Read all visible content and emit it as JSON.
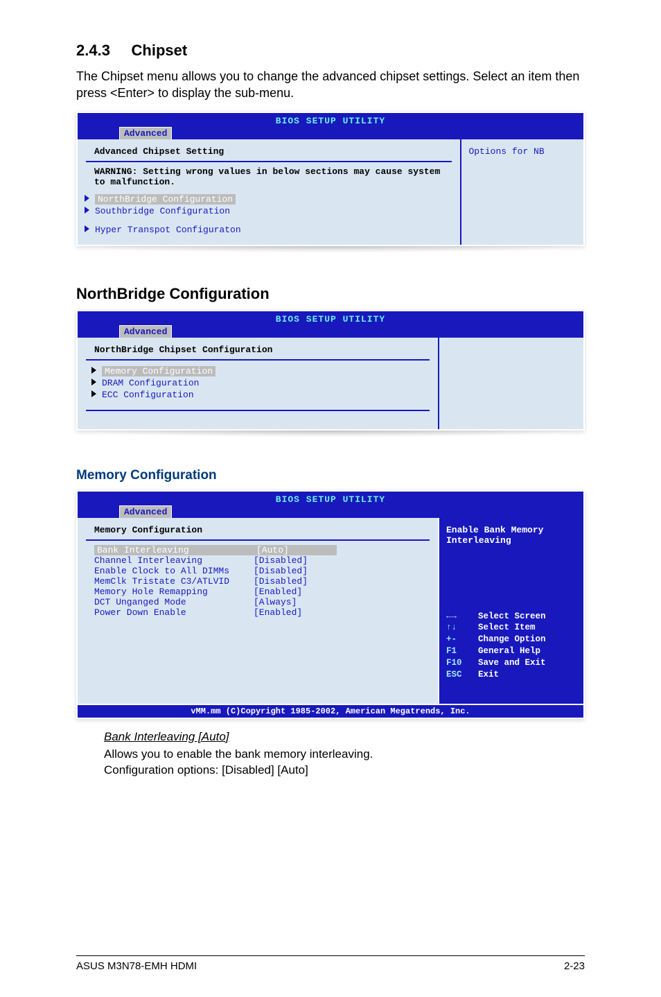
{
  "section": {
    "number": "2.4.3",
    "title": "Chipset",
    "intro": "The Chipset menu allows you to change the advanced chipset settings. Select an item then press <Enter> to display the sub-menu."
  },
  "bios1": {
    "header_title": "BIOS SETUP UTILITY",
    "tab": "Advanced",
    "left_heading": "Advanced Chipset Setting",
    "warning": "WARNING: Setting wrong values in below sections may cause system to malfunction.",
    "item_highlight": "NorthBridge Configuration",
    "item2": "Southbridge Configuration",
    "item3": "Hyper Transpot Configuraton",
    "right_text": "Options for NB"
  },
  "northbridge_heading": "NorthBridge Configuration",
  "bios2": {
    "header_title": "BIOS SETUP UTILITY",
    "tab": "Advanced",
    "left_heading": "NorthBridge Chipset Configuration",
    "item_highlight": "Memory Configuration",
    "item2": "DRAM Configuration",
    "item3": "ECC Configuration"
  },
  "memory_heading": "Memory Configuration",
  "bios3": {
    "header_title": "BIOS SETUP UTILITY",
    "tab": "Advanced",
    "left_heading": "Memory Configuration",
    "rows": [
      {
        "label": "Bank Interleaving",
        "value": "[Auto]",
        "hl": true
      },
      {
        "label": "Channel Interleaving",
        "value": "[Disabled]"
      },
      {
        "label": "Enable Clock to All DIMMs",
        "value": "[Disabled]"
      },
      {
        "label": "MemClk Tristate C3/ATLVID",
        "value": "[Disabled]"
      },
      {
        "label": "Memory Hole Remapping",
        "value": "[Enabled]"
      },
      {
        "label": "DCT Unganged Mode",
        "value": "[Always]"
      },
      {
        "label": "Power Down Enable",
        "value": "[Enabled]"
      }
    ],
    "right_line1": "Enable Bank Memory",
    "right_line2": "Interleaving",
    "keys": [
      {
        "k": "←→",
        "d": "Select Screen"
      },
      {
        "k": "↑↓",
        "d": "Select Item"
      },
      {
        "k": "+-",
        "d": "Change Option"
      },
      {
        "k": "F1",
        "d": "General Help"
      },
      {
        "k": "F10",
        "d": "Save and Exit"
      },
      {
        "k": "ESC",
        "d": "Exit"
      }
    ],
    "footer": "vMM.mm (C)Copyright 1985-2002, American Megatrends, Inc."
  },
  "bank": {
    "link": "Bank Interleaving [Auto]",
    "desc": "Allows you to enable the bank memory interleaving.",
    "opts": "Configuration options: [Disabled] [Auto]"
  },
  "footer": {
    "left": "ASUS M3N78-EMH HDMI",
    "right": "2-23"
  }
}
